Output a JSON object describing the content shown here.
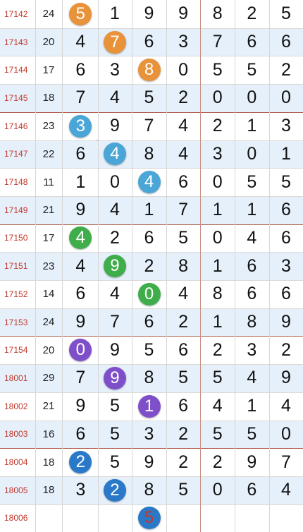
{
  "rows": [
    {
      "period": "17142",
      "sum": "24",
      "digits": [
        "5",
        "1",
        "9",
        "9",
        "8",
        "2",
        "5"
      ]
    },
    {
      "period": "17143",
      "sum": "20",
      "digits": [
        "4",
        "7",
        "6",
        "3",
        "7",
        "6",
        "6"
      ]
    },
    {
      "period": "17144",
      "sum": "17",
      "digits": [
        "6",
        "3",
        "8",
        "0",
        "5",
        "5",
        "2"
      ]
    },
    {
      "period": "17145",
      "sum": "18",
      "digits": [
        "7",
        "4",
        "5",
        "2",
        "0",
        "0",
        "0"
      ]
    },
    {
      "period": "17146",
      "sum": "23",
      "digits": [
        "3",
        "9",
        "7",
        "4",
        "2",
        "1",
        "3"
      ]
    },
    {
      "period": "17147",
      "sum": "22",
      "digits": [
        "6",
        "4",
        "8",
        "4",
        "3",
        "0",
        "1"
      ]
    },
    {
      "period": "17148",
      "sum": "11",
      "digits": [
        "1",
        "0",
        "4",
        "6",
        "0",
        "5",
        "5"
      ]
    },
    {
      "period": "17149",
      "sum": "21",
      "digits": [
        "9",
        "4",
        "1",
        "7",
        "1",
        "1",
        "6"
      ]
    },
    {
      "period": "17150",
      "sum": "17",
      "digits": [
        "4",
        "2",
        "6",
        "5",
        "0",
        "4",
        "6"
      ]
    },
    {
      "period": "17151",
      "sum": "23",
      "digits": [
        "4",
        "9",
        "2",
        "8",
        "1",
        "6",
        "3"
      ]
    },
    {
      "period": "17152",
      "sum": "14",
      "digits": [
        "6",
        "4",
        "0",
        "4",
        "8",
        "6",
        "6"
      ]
    },
    {
      "period": "17153",
      "sum": "24",
      "digits": [
        "9",
        "7",
        "6",
        "2",
        "1",
        "8",
        "9"
      ]
    },
    {
      "period": "17154",
      "sum": "20",
      "digits": [
        "0",
        "9",
        "5",
        "6",
        "2",
        "3",
        "2"
      ]
    },
    {
      "period": "18001",
      "sum": "29",
      "digits": [
        "7",
        "9",
        "8",
        "5",
        "5",
        "4",
        "9"
      ]
    },
    {
      "period": "18002",
      "sum": "21",
      "digits": [
        "9",
        "5",
        "1",
        "6",
        "4",
        "1",
        "4"
      ]
    },
    {
      "period": "18003",
      "sum": "16",
      "digits": [
        "6",
        "5",
        "3",
        "2",
        "5",
        "5",
        "0"
      ]
    },
    {
      "period": "18004",
      "sum": "18",
      "digits": [
        "2",
        "5",
        "9",
        "2",
        "2",
        "9",
        "7"
      ]
    },
    {
      "period": "18005",
      "sum": "18",
      "digits": [
        "3",
        "2",
        "8",
        "5",
        "0",
        "6",
        "4"
      ]
    },
    {
      "period": "18006",
      "sum": "",
      "digits": [
        "",
        "",
        "5",
        "",
        "",
        "",
        ""
      ]
    }
  ],
  "highlights": [
    {
      "row": 0,
      "col": 0,
      "color": "#e8923a"
    },
    {
      "row": 1,
      "col": 1,
      "color": "#e8923a"
    },
    {
      "row": 2,
      "col": 2,
      "color": "#e8923a"
    },
    {
      "row": 4,
      "col": 0,
      "color": "#4aa6d6"
    },
    {
      "row": 5,
      "col": 1,
      "color": "#4aa6d6"
    },
    {
      "row": 6,
      "col": 2,
      "color": "#4aa6d6"
    },
    {
      "row": 8,
      "col": 0,
      "color": "#3fae4a"
    },
    {
      "row": 9,
      "col": 1,
      "color": "#3fae4a"
    },
    {
      "row": 10,
      "col": 2,
      "color": "#3fae4a"
    },
    {
      "row": 12,
      "col": 0,
      "color": "#7f4fc9"
    },
    {
      "row": 13,
      "col": 1,
      "color": "#7f4fc9"
    },
    {
      "row": 14,
      "col": 2,
      "color": "#7f4fc9"
    },
    {
      "row": 16,
      "col": 0,
      "color": "#2a78c8"
    },
    {
      "row": 17,
      "col": 1,
      "color": "#2a78c8"
    },
    {
      "row": 18,
      "col": 2,
      "color": "#2a78c8"
    }
  ],
  "last_ball_text_color": "#c0392b"
}
